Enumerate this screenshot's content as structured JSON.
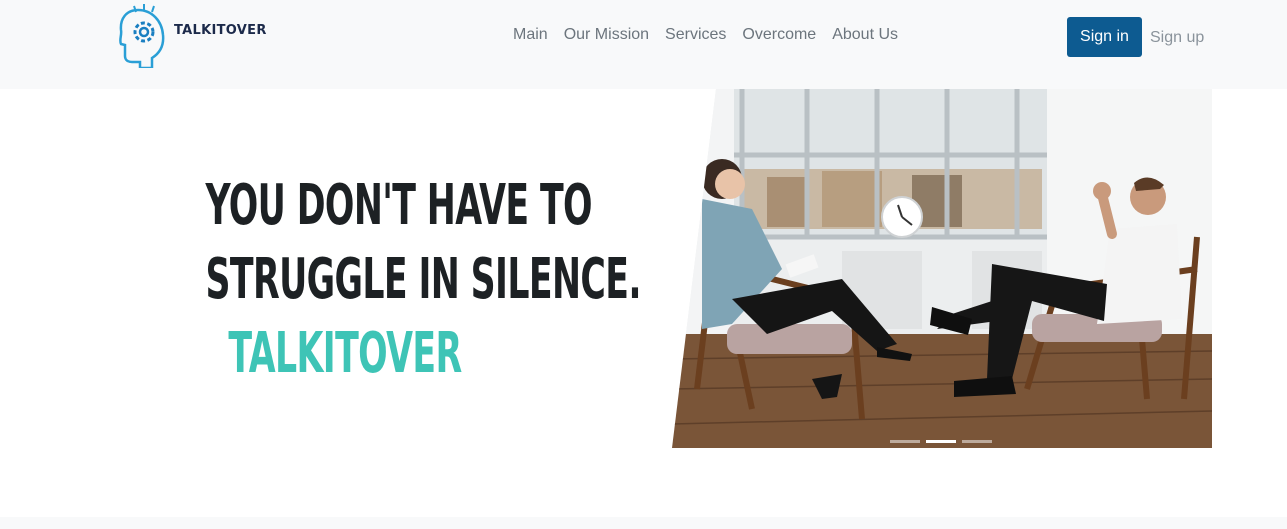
{
  "brand": {
    "name": "TALKITOVER",
    "logo_icon": "head-gear-icon"
  },
  "nav": {
    "items": [
      {
        "label": "Main"
      },
      {
        "label": "Our Mission"
      },
      {
        "label": "Services"
      },
      {
        "label": "Overcome"
      },
      {
        "label": "About Us"
      }
    ]
  },
  "auth": {
    "sign_in": "Sign in",
    "sign_up": "Sign up"
  },
  "hero": {
    "line1": "YOU DON'T HAVE TO",
    "line2": "STRUGGLE IN SILENCE.",
    "line3": "TALKITOVER",
    "image_alt": "therapy-session-photo",
    "carousel": {
      "slides": 3,
      "active": 2
    }
  },
  "colors": {
    "accent": "#3ec4b6",
    "primary": "#0d5b91",
    "nav_bg": "#f8f9fa",
    "text_dark": "#1d2124"
  }
}
